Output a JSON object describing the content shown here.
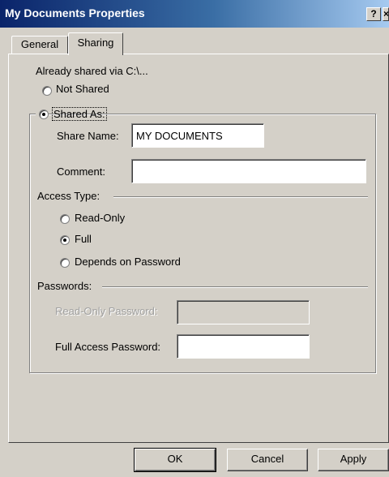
{
  "window": {
    "title": "My Documents Properties",
    "help_glyph": "?",
    "close_glyph": "×"
  },
  "tabs": [
    {
      "label": "General"
    },
    {
      "label": "Sharing"
    }
  ],
  "sharing": {
    "status_text": "Already shared via C:\\...",
    "not_shared_label": "Not Shared",
    "shared_as_label": "Shared As:",
    "share_name_label": "Share Name:",
    "share_name_value": "MY DOCUMENTS",
    "comment_label": "Comment:",
    "comment_value": "",
    "access_type_label": "Access Type:",
    "read_only_label": "Read-Only",
    "full_label": "Full",
    "depends_label": "Depends on Password",
    "passwords_label": "Passwords:",
    "read_only_password_label": "Read-Only Password:",
    "read_only_password_value": "",
    "full_access_password_label": "Full Access Password:",
    "full_access_password_value": "",
    "selected_share_option": "Shared As:",
    "selected_access_option": "Full"
  },
  "buttons": {
    "ok": "OK",
    "cancel": "Cancel",
    "apply": "Apply"
  }
}
